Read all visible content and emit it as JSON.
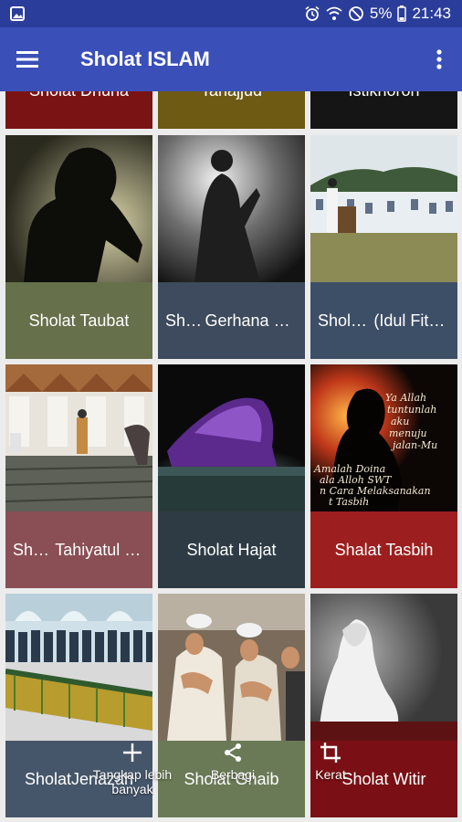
{
  "status_bar": {
    "battery": "5%",
    "time": "21:43",
    "icons": [
      "gallery-icon",
      "alarm-icon",
      "wifi-icon",
      "no-disturb-icon",
      "battery-icon"
    ]
  },
  "app_bar": {
    "title": "Sholat ISLAM",
    "icons": [
      "hamburger-menu-icon",
      "more-vert-icon"
    ]
  },
  "tiles": [
    {
      "line1": "Sholat Dhuha",
      "line2": "",
      "caption_color": "#7a1414"
    },
    {
      "line1": "Tahajjud",
      "line2": "",
      "caption_color": "#6f5a14"
    },
    {
      "line1": "Istikhoroh",
      "line2": "",
      "caption_color": "#151515"
    },
    {
      "line1": "Sholat Taubat",
      "line2": "",
      "caption_color": "#66704b"
    },
    {
      "line1": "Sholat",
      "line2": "Gerhana Bul…",
      "caption_color": "#3e4a5d"
    },
    {
      "line1": "Sholat 'Ied",
      "line2": "(Idul Fitri & I…",
      "caption_color": "#3d4f67"
    },
    {
      "line1": "Shalat",
      "line2": "Tahiyatul M…",
      "caption_color": "#8a4f55"
    },
    {
      "line1": "Sholat Hajat",
      "line2": "",
      "caption_color": "#2e3b44"
    },
    {
      "line1": "Shalat Tasbih",
      "line2": "",
      "caption_color": "#9c1e1e"
    },
    {
      "line1": "Sholat",
      "line2": "Jenazah",
      "caption_color": "#46566a"
    },
    {
      "line1": "Sholat Ghaib",
      "line2": "",
      "caption_color": "#6a7a56"
    },
    {
      "line1": "Sholat Witir",
      "line2": "",
      "caption_color": "#7a1015"
    }
  ],
  "bottom_actions": [
    {
      "label": "Tangkap lebih banyak",
      "icon": "plus-icon"
    },
    {
      "label": "Berbagi",
      "icon": "share-icon"
    },
    {
      "label": "Kerat",
      "icon": "crop-icon"
    }
  ],
  "colors": {
    "status_bar": "#2b3d9a",
    "app_bar": "#3b4fb8",
    "background": "#ececec"
  }
}
